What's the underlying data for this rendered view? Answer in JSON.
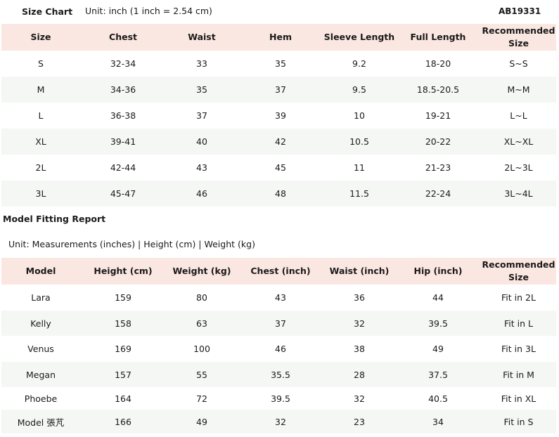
{
  "size_chart": {
    "title": "Size Chart",
    "unit": "Unit: inch (1 inch = 2.54 cm)",
    "code": "AB19331",
    "headers": [
      "Size",
      "Chest",
      "Waist",
      "Hem",
      "Sleeve Length",
      "Full Length",
      "Recommended Size"
    ],
    "rows": [
      [
        "S",
        "32-34",
        "33",
        "35",
        "9.2",
        "18-20",
        "S~S"
      ],
      [
        "M",
        "34-36",
        "35",
        "37",
        "9.5",
        "18.5-20.5",
        "M~M"
      ],
      [
        "L",
        "36-38",
        "37",
        "39",
        "10",
        "19-21",
        "L~L"
      ],
      [
        "XL",
        "39-41",
        "40",
        "42",
        "10.5",
        "20-22",
        "XL~XL"
      ],
      [
        "2L",
        "42-44",
        "43",
        "45",
        "11",
        "21-23",
        "2L~3L"
      ],
      [
        "3L",
        "45-47",
        "46",
        "48",
        "11.5",
        "22-24",
        "3L~4L"
      ]
    ]
  },
  "model_report": {
    "title": "Model Fitting Report",
    "unit": "Unit: Measurements (inches) | Height (cm) | Weight (kg)",
    "headers": [
      "Model",
      "Height (cm)",
      "Weight (kg)",
      "Chest (inch)",
      "Waist (inch)",
      "Hip (inch)",
      "Recommended Size"
    ],
    "rows": [
      [
        "Lara",
        "159",
        "80",
        "43",
        "36",
        "44",
        "Fit in 2L"
      ],
      [
        "Kelly",
        "158",
        "63",
        "37",
        "32",
        "39.5",
        "Fit in L"
      ],
      [
        "Venus",
        "169",
        "100",
        "46",
        "38",
        "49",
        "Fit in 3L"
      ],
      [
        "Megan",
        "157",
        "55",
        "35.5",
        "28",
        "37.5",
        "Fit in M"
      ],
      [
        "Phoebe",
        "164",
        "72",
        "39.5",
        "32",
        "40.5",
        "Fit in XL"
      ],
      [
        "Model 張芃",
        "166",
        "49",
        "32",
        "23",
        "34",
        "Fit in S"
      ]
    ]
  },
  "colors": {
    "header_bg": "#fbe7e1",
    "stripe_bg": "#f5f7f5"
  }
}
